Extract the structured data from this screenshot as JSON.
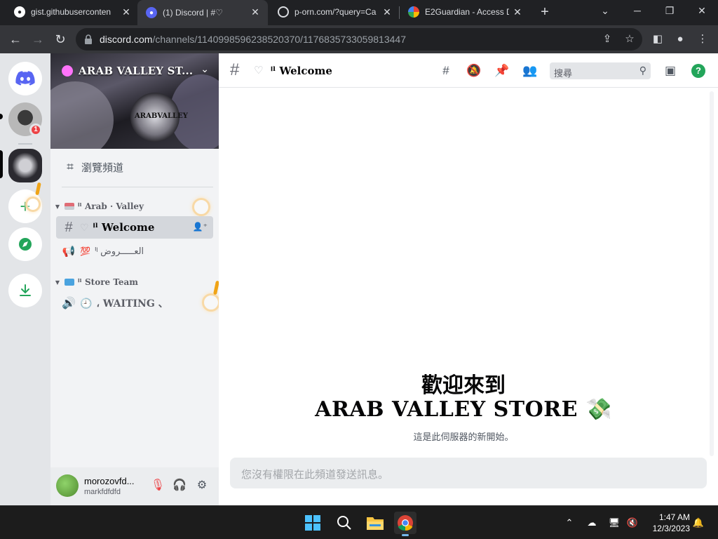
{
  "browser": {
    "tabs": [
      {
        "title": "gist.githubuserconten",
        "favicon": "github-icon",
        "active": false
      },
      {
        "title": "(1) Discord | #♡ ",
        "favicon": "discord-icon",
        "active": true
      },
      {
        "title": "p-orn.com/?query=Ca",
        "favicon": "globe-icon",
        "active": false
      },
      {
        "title": "E2Guardian - Access D",
        "favicon": "google-icon",
        "active": false
      }
    ],
    "url_host": "discord.com",
    "url_path": "/channels/1140998596238520370/1176835733059813447"
  },
  "discord": {
    "server_name": "ARAB VALLEY ST...",
    "banner_logo_text": "ARABVALLEY",
    "browse_label": "瀏覽頻道",
    "dm_badge": "1",
    "categories": [
      {
        "name": "ᑊˡ Arab · Valley",
        "channels": [
          {
            "type": "text",
            "emoji": "♡",
            "name": "ᑊˡ Welcome",
            "selected": true
          },
          {
            "type": "announcement",
            "emoji": "💯",
            "name": "ᑊˡ العـــــروض",
            "selected": false
          }
        ]
      },
      {
        "name": "ᑊˡ Store Team",
        "channels": [
          {
            "type": "voice",
            "emoji": "🕘",
            "name": "، WAITING 、",
            "selected": false
          }
        ]
      }
    ],
    "user": {
      "name": "morozovfd...",
      "tag": "markfdfdfd"
    },
    "header": {
      "emoji": "♡",
      "title": "ᑊˡ Welcome",
      "search_placeholder": "搜尋"
    },
    "welcome": {
      "line1": "歡迎來到",
      "line2": "ARAB VALLEY STORE 💸",
      "sub": "這是此伺服器的新開始。"
    },
    "composer_placeholder": "您沒有權限在此頻道發送訊息。"
  },
  "taskbar": {
    "time": "1:47 AM",
    "date": "12/3/2023"
  },
  "colors": {
    "discord_blurple": "#5865f2",
    "online_green": "#23a55a",
    "badge_red": "#ed4245",
    "attention_orange": "#f0a417"
  }
}
